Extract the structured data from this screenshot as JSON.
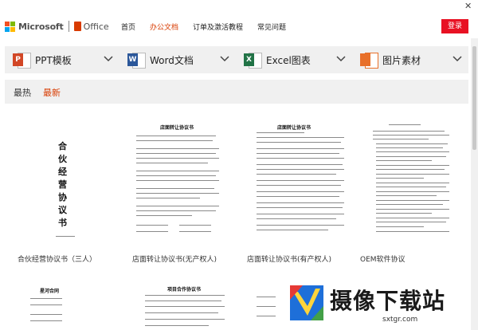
{
  "window": {
    "close_glyph": "✕"
  },
  "header": {
    "brand": "Microsoft",
    "product": "Office",
    "nav": [
      {
        "label": "首页",
        "active": false
      },
      {
        "label": "办公文档",
        "active": true
      },
      {
        "label": "订单及激活教程",
        "active": false
      },
      {
        "label": "常见问题",
        "active": false
      }
    ],
    "login_label": "登录"
  },
  "categories": [
    {
      "label": "PPT模板",
      "badge": "P",
      "color": "#d24726",
      "icon": "powerpoint-icon"
    },
    {
      "label": "Word文档",
      "badge": "W",
      "color": "#2b579a",
      "icon": "word-icon"
    },
    {
      "label": "Excel图表",
      "badge": "X",
      "color": "#217346",
      "icon": "excel-icon"
    },
    {
      "label": "图片素材",
      "badge": "",
      "color": "#e8702a",
      "icon": "image-icon"
    }
  ],
  "sort": {
    "hot": "最热",
    "newest": "最新"
  },
  "docs": [
    {
      "title": "合伙经营协议书（三人）",
      "cover_text": "合伙经营协议书"
    },
    {
      "title": "店面转让协议书(无产权人)",
      "cover_text": "店面转让协议书"
    },
    {
      "title": "店面转让协议书(有产权人)",
      "cover_text": "店面转让协议书"
    },
    {
      "title": "OEM软件协议",
      "cover_text": ""
    }
  ],
  "docs_row2": [
    {
      "cover_text": "星河合同"
    },
    {
      "cover_text": "项目合作协议书"
    },
    {
      "cover_text": ""
    }
  ],
  "watermark": {
    "text": "摄像下载站",
    "sub": "sxtgr.com"
  },
  "colors": {
    "accent": "#d83b01",
    "login_bg": "#e81123",
    "bar_bg": "#f0f0f0"
  }
}
